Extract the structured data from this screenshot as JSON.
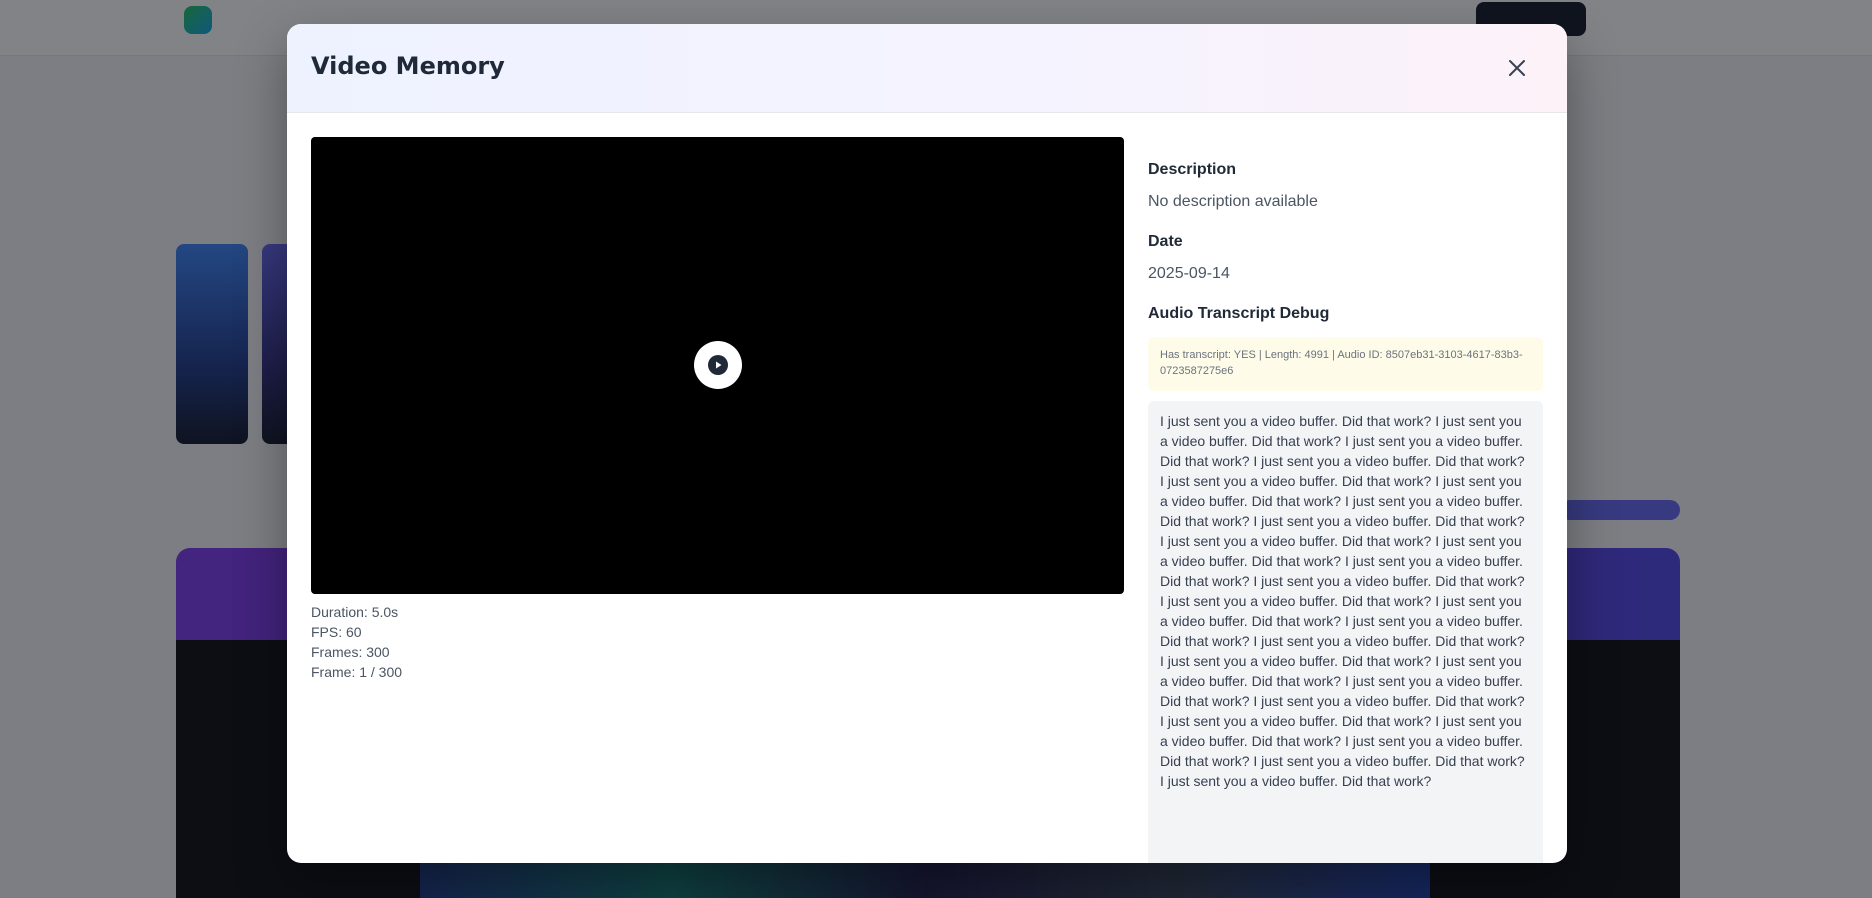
{
  "background": {
    "brand": "",
    "section_title": "",
    "banner_title": ""
  },
  "modal": {
    "title": "Video Memory",
    "close_icon": "close-icon"
  },
  "video": {
    "play_icon": "play-icon",
    "duration": "Duration: 5.0s",
    "fps": "FPS: 60",
    "frames": "Frames: 300",
    "frame": "Frame: 1 / 300"
  },
  "details": {
    "description_label": "Description",
    "description_value": "No description available",
    "date_label": "Date",
    "date_value": "2025-09-14",
    "audio_label": "Audio Transcript Debug",
    "debug_text": "Has transcript: YES | Length: 4991 | Audio ID: 8507eb31-3103-4617-83b3-0723587275e6",
    "transcript_text": "I just sent you a video buffer. Did that work? I just sent you a video buffer. Did that work? I just sent you a video buffer. Did that work? I just sent you a video buffer. Did that work? I just sent you a video buffer. Did that work? I just sent you a video buffer. Did that work? I just sent you a video buffer. Did that work? I just sent you a video buffer. Did that work? I just sent you a video buffer. Did that work? I just sent you a video buffer. Did that work? I just sent you a video buffer. Did that work? I just sent you a video buffer. Did that work? I just sent you a video buffer. Did that work? I just sent you a video buffer. Did that work? I just sent you a video buffer. Did that work? I just sent you a video buffer. Did that work? I just sent you a video buffer. Did that work? I just sent you a video buffer. Did that work? I just sent you a video buffer. Did that work? I just sent you a video buffer. Did that work? I just sent you a video buffer. Did that work? I just sent you a video buffer. Did that work? I just sent you a video buffer. Did that work? I just sent you a video buffer. Did that work? I just sent you a video buffer. Did that work?"
  },
  "colors": {
    "overlay": "#0f1219",
    "accent": "#6366f1",
    "debug_bg": "#fefce8"
  }
}
